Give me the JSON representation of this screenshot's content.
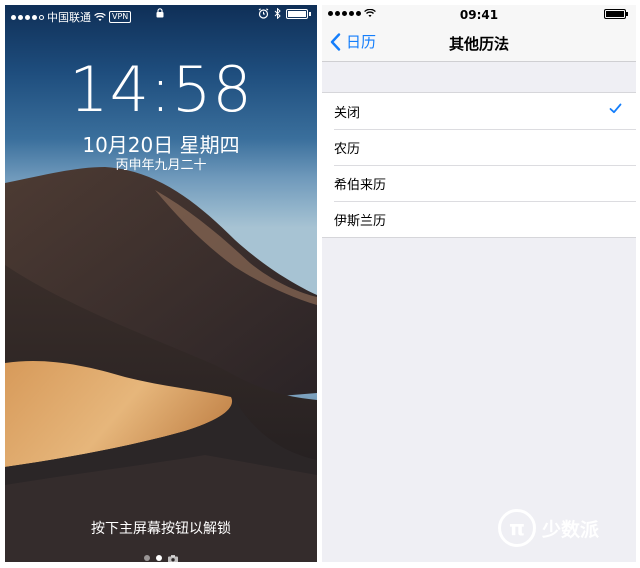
{
  "lock_screen": {
    "status": {
      "carrier": "中国联通",
      "vpn": "VPN"
    },
    "time": "14:58",
    "date": "10月20日 星期四",
    "lunar_date": "丙申年九月二十",
    "unlock_hint": "按下主屏幕按钮以解锁",
    "page_indicator": {
      "pages": 2,
      "active_index": 1
    }
  },
  "settings": {
    "status": {
      "time": "09:41"
    },
    "nav": {
      "back_label": "日历",
      "title": "其他历法"
    },
    "options": [
      {
        "label": "关闭",
        "selected": true
      },
      {
        "label": "农历",
        "selected": false
      },
      {
        "label": "希伯来历",
        "selected": false
      },
      {
        "label": "伊斯兰历",
        "selected": false
      }
    ],
    "accent_color": "#147efb"
  },
  "watermark": {
    "text": "少数派",
    "logo": "π"
  },
  "icons": [
    "wifi-icon",
    "lock-icon",
    "alarm-icon",
    "bluetooth-icon",
    "battery-icon",
    "camera-icon",
    "chevron-left-icon",
    "checkmark-icon"
  ]
}
